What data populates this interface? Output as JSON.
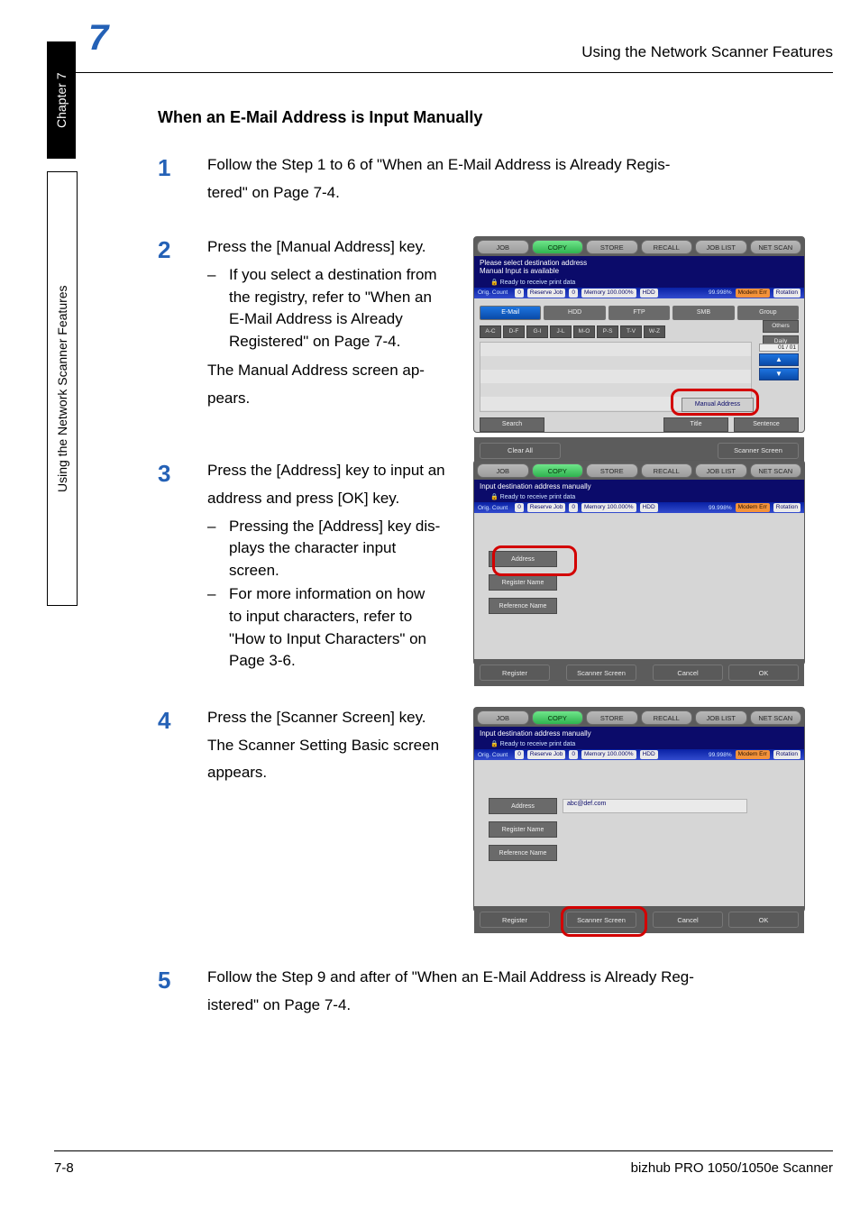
{
  "header": {
    "number": "7",
    "right": "Using the Network Scanner Features"
  },
  "sidebar": {
    "chapter": "Chapter 7",
    "feature": "Using the Network Scanner Features"
  },
  "section_title": "When an E-Mail Address is Input Manually",
  "steps": {
    "s1": {
      "num": "1",
      "line1": "Follow the Step 1 to 6 of \"When an E-Mail Address is Already Regis-",
      "line2": "tered\" on Page 7-4."
    },
    "s2": {
      "num": "2",
      "lead": "Press the [Manual Address] key.",
      "bullet1_l1": "If you select a destination from",
      "bullet1_l2": "the registry, refer to \"When an",
      "bullet1_l3": "E-Mail Address is Already",
      "bullet1_l4": "Registered\" on Page 7-4.",
      "tail_l1": "The Manual Address screen ap-",
      "tail_l2": "pears."
    },
    "s3": {
      "num": "3",
      "lead_l1": "Press the [Address] key to input an",
      "lead_l2": "address and press [OK] key.",
      "bullet1_l1": "Pressing the [Address] key dis-",
      "bullet1_l2": "plays the character input",
      "bullet1_l3": "screen.",
      "bullet2_l1": "For more information on how",
      "bullet2_l2": "to input characters, refer to",
      "bullet2_l3": "\"How to Input Characters\" on",
      "bullet2_l4": "Page 3-6."
    },
    "s4": {
      "num": "4",
      "lead": "Press the [Scanner Screen] key.",
      "tail_l1": "The Scanner Setting Basic screen",
      "tail_l2": "appears."
    },
    "s5": {
      "num": "5",
      "line1": "Follow the Step 9 and after of \"When an E-Mail Address is Already Reg-",
      "line2": "istered\" on Page 7-4."
    }
  },
  "footer": {
    "left": "7-8",
    "right": "bizhub PRO 1050/1050e Scanner"
  },
  "scanner": {
    "tabs": [
      "JOB",
      "COPY",
      "STORE",
      "RECALL",
      "JOB LIST",
      "NET SCAN"
    ],
    "title_select": "Please select destination address\nManual Input is available",
    "title_manual": "Input destination address manually",
    "status_ready": "Ready to receive print data",
    "status_chips": {
      "orig": "Orig. Count",
      "reserve": "Reserve Job",
      "memory": "Memory  100.000%",
      "hdd": "HDD",
      "hdd_pct": "99.998%",
      "modem": "Modem Err",
      "rotation": "Rotation"
    },
    "methods": [
      "E-Mail",
      "HDD",
      "FTP",
      "SMB",
      "Group"
    ],
    "alpha": [
      "A-C",
      "D-F",
      "G-I",
      "J-L",
      "M-O",
      "P-S",
      "T-V",
      "W-Z"
    ],
    "others": "Others",
    "daily": "Daily",
    "pager": "01 / 01",
    "manual_address": "Manual Address",
    "btn_search": "Search",
    "btn_title": "Title",
    "btn_sentence": "Sentence",
    "btn_clear_all": "Clear All",
    "btn_scanner_screen": "Scanner Screen",
    "btn_address": "Address",
    "btn_register_name": "Register Name",
    "btn_reference_name": "Reference Name",
    "btn_register": "Register",
    "btn_cancel": "Cancel",
    "btn_ok": "OK",
    "address_value": "abc@def.com"
  }
}
